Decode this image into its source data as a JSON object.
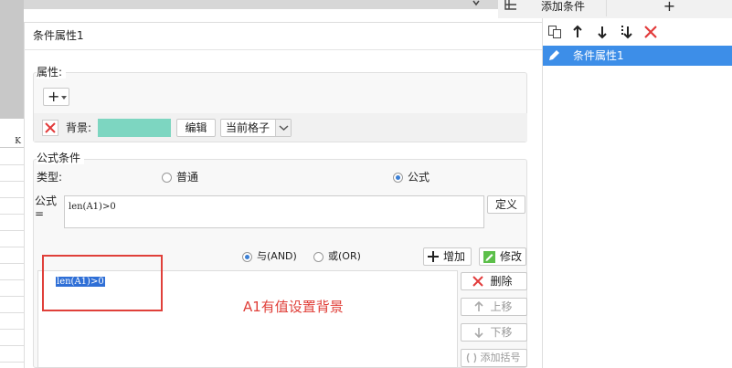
{
  "top_bar": {
    "add_condition_tab": "添加条件",
    "plus_tab": "+"
  },
  "sheet": {
    "column_letter": "K"
  },
  "dialog": {
    "title": "条件属性1",
    "attributes_label": "属性:",
    "add_button": "+",
    "background_label": "背景:",
    "background_color": "#7dd6c1",
    "edit_button": "编辑",
    "scope_value": "当前格子",
    "formula_section_label": "公式条件",
    "type_label": "类型:",
    "type_options": [
      "普通",
      "公式"
    ],
    "type_selected": "公式",
    "formula_label": "公式=",
    "formula_value": "len(A1)>0",
    "define_button": "定义",
    "logic_options": [
      "与(AND)",
      "或(OR)"
    ],
    "logic_selected": "与(AND)",
    "add_cond_button": "增加",
    "modify_button": "修改",
    "conditions": [
      "len(A1)>0"
    ],
    "delete_button": "删除",
    "move_up_button": "上移",
    "move_down_button": "下移",
    "add_bracket_button": "添加括号"
  },
  "side_panel": {
    "items": [
      "条件属性1"
    ],
    "accent_color": "#3d8ee8"
  },
  "annotation": {
    "text": "A1有值设置背景",
    "color": "#e0403a"
  }
}
